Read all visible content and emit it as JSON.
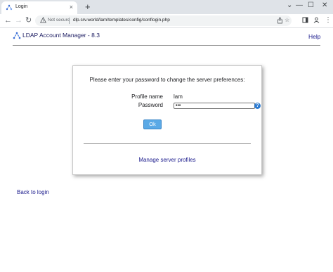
{
  "browser": {
    "tab_title": "Login",
    "tab_close_glyph": "×",
    "new_tab_glyph": "+",
    "window_controls": {
      "chevron": "⌄",
      "minimize": "—",
      "maximize": "☐",
      "close": "✕"
    },
    "nav": {
      "back": "←",
      "forward": "→",
      "reload": "↻"
    },
    "security_label": "Not secure",
    "url": "dlp.srv.world/lam/templates/config/conflogin.php",
    "omnibox_icons": [
      "share-icon",
      "star-icon"
    ],
    "toolbar_icons": [
      "extensions-icon",
      "sidepanel-icon",
      "profile-icon",
      "menu-icon"
    ]
  },
  "header": {
    "app_title": "LDAP Account Manager - 8.3",
    "help_link": "Help"
  },
  "dialog": {
    "prompt": "Please enter your password to change the server preferences:",
    "profile_label": "Profile name",
    "profile_value": "lam",
    "password_label": "Password",
    "password_value": "•••",
    "help_glyph": "?",
    "ok_button": "Ok",
    "manage_link": "Manage server profiles"
  },
  "footer": {
    "back_link": "Back to login"
  },
  "colors": {
    "link": "#1a1a8c",
    "ok_button": "#5aa9e6",
    "help_icon": "#2c7bd1",
    "tabbar": "#dfe3e8"
  }
}
